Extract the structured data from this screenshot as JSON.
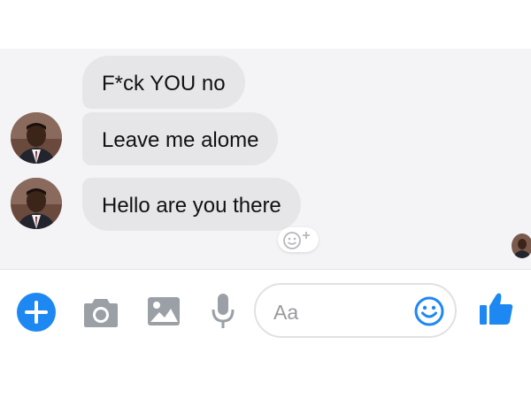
{
  "conversation": {
    "messages": [
      {
        "text": "F*ck YOU no"
      },
      {
        "text": "Leave me alome"
      },
      {
        "text": "Hello are you there"
      }
    ]
  },
  "composer": {
    "placeholder": "Aa"
  },
  "icons": {
    "add": "plus-icon",
    "camera": "camera-icon",
    "gallery": "image-icon",
    "mic": "microphone-icon",
    "emoji": "smiley-icon",
    "like": "thumbs-up-icon",
    "react": "add-reaction-icon"
  },
  "colors": {
    "accent": "#1e88f2",
    "bubble": "#e6e6e9",
    "icon_gray": "#9aa0a6"
  }
}
